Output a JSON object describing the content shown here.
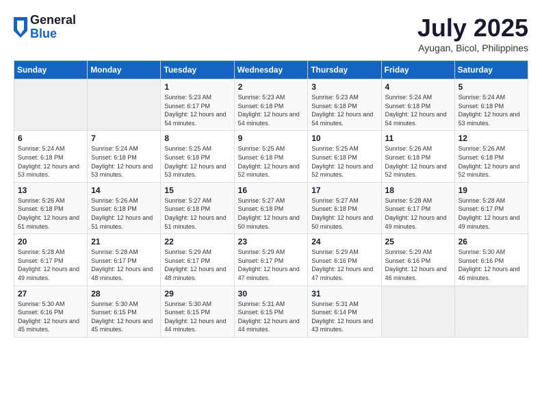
{
  "header": {
    "logo": {
      "line1": "General",
      "line2": "Blue"
    },
    "title": "July 2025",
    "location": "Ayugan, Bicol, Philippines"
  },
  "weekdays": [
    "Sunday",
    "Monday",
    "Tuesday",
    "Wednesday",
    "Thursday",
    "Friday",
    "Saturday"
  ],
  "weeks": [
    [
      {
        "day": "",
        "info": ""
      },
      {
        "day": "",
        "info": ""
      },
      {
        "day": "1",
        "info": "Sunrise: 5:23 AM\nSunset: 6:17 PM\nDaylight: 12 hours and 54 minutes."
      },
      {
        "day": "2",
        "info": "Sunrise: 5:23 AM\nSunset: 6:18 PM\nDaylight: 12 hours and 54 minutes."
      },
      {
        "day": "3",
        "info": "Sunrise: 5:23 AM\nSunset: 6:18 PM\nDaylight: 12 hours and 54 minutes."
      },
      {
        "day": "4",
        "info": "Sunrise: 5:24 AM\nSunset: 6:18 PM\nDaylight: 12 hours and 54 minutes."
      },
      {
        "day": "5",
        "info": "Sunrise: 5:24 AM\nSunset: 6:18 PM\nDaylight: 12 hours and 53 minutes."
      }
    ],
    [
      {
        "day": "6",
        "info": "Sunrise: 5:24 AM\nSunset: 6:18 PM\nDaylight: 12 hours and 53 minutes."
      },
      {
        "day": "7",
        "info": "Sunrise: 5:24 AM\nSunset: 6:18 PM\nDaylight: 12 hours and 53 minutes."
      },
      {
        "day": "8",
        "info": "Sunrise: 5:25 AM\nSunset: 6:18 PM\nDaylight: 12 hours and 53 minutes."
      },
      {
        "day": "9",
        "info": "Sunrise: 5:25 AM\nSunset: 6:18 PM\nDaylight: 12 hours and 52 minutes."
      },
      {
        "day": "10",
        "info": "Sunrise: 5:25 AM\nSunset: 6:18 PM\nDaylight: 12 hours and 52 minutes."
      },
      {
        "day": "11",
        "info": "Sunrise: 5:26 AM\nSunset: 6:18 PM\nDaylight: 12 hours and 52 minutes."
      },
      {
        "day": "12",
        "info": "Sunrise: 5:26 AM\nSunset: 6:18 PM\nDaylight: 12 hours and 52 minutes."
      }
    ],
    [
      {
        "day": "13",
        "info": "Sunrise: 5:26 AM\nSunset: 6:18 PM\nDaylight: 12 hours and 51 minutes."
      },
      {
        "day": "14",
        "info": "Sunrise: 5:26 AM\nSunset: 6:18 PM\nDaylight: 12 hours and 51 minutes."
      },
      {
        "day": "15",
        "info": "Sunrise: 5:27 AM\nSunset: 6:18 PM\nDaylight: 12 hours and 51 minutes."
      },
      {
        "day": "16",
        "info": "Sunrise: 5:27 AM\nSunset: 6:18 PM\nDaylight: 12 hours and 50 minutes."
      },
      {
        "day": "17",
        "info": "Sunrise: 5:27 AM\nSunset: 6:18 PM\nDaylight: 12 hours and 50 minutes."
      },
      {
        "day": "18",
        "info": "Sunrise: 5:28 AM\nSunset: 6:17 PM\nDaylight: 12 hours and 49 minutes."
      },
      {
        "day": "19",
        "info": "Sunrise: 5:28 AM\nSunset: 6:17 PM\nDaylight: 12 hours and 49 minutes."
      }
    ],
    [
      {
        "day": "20",
        "info": "Sunrise: 5:28 AM\nSunset: 6:17 PM\nDaylight: 12 hours and 49 minutes."
      },
      {
        "day": "21",
        "info": "Sunrise: 5:28 AM\nSunset: 6:17 PM\nDaylight: 12 hours and 48 minutes."
      },
      {
        "day": "22",
        "info": "Sunrise: 5:29 AM\nSunset: 6:17 PM\nDaylight: 12 hours and 48 minutes."
      },
      {
        "day": "23",
        "info": "Sunrise: 5:29 AM\nSunset: 6:17 PM\nDaylight: 12 hours and 47 minutes."
      },
      {
        "day": "24",
        "info": "Sunrise: 5:29 AM\nSunset: 6:16 PM\nDaylight: 12 hours and 47 minutes."
      },
      {
        "day": "25",
        "info": "Sunrise: 5:29 AM\nSunset: 6:16 PM\nDaylight: 12 hours and 46 minutes."
      },
      {
        "day": "26",
        "info": "Sunrise: 5:30 AM\nSunset: 6:16 PM\nDaylight: 12 hours and 46 minutes."
      }
    ],
    [
      {
        "day": "27",
        "info": "Sunrise: 5:30 AM\nSunset: 6:16 PM\nDaylight: 12 hours and 45 minutes."
      },
      {
        "day": "28",
        "info": "Sunrise: 5:30 AM\nSunset: 6:15 PM\nDaylight: 12 hours and 45 minutes."
      },
      {
        "day": "29",
        "info": "Sunrise: 5:30 AM\nSunset: 6:15 PM\nDaylight: 12 hours and 44 minutes."
      },
      {
        "day": "30",
        "info": "Sunrise: 5:31 AM\nSunset: 6:15 PM\nDaylight: 12 hours and 44 minutes."
      },
      {
        "day": "31",
        "info": "Sunrise: 5:31 AM\nSunset: 6:14 PM\nDaylight: 12 hours and 43 minutes."
      },
      {
        "day": "",
        "info": ""
      },
      {
        "day": "",
        "info": ""
      }
    ]
  ]
}
